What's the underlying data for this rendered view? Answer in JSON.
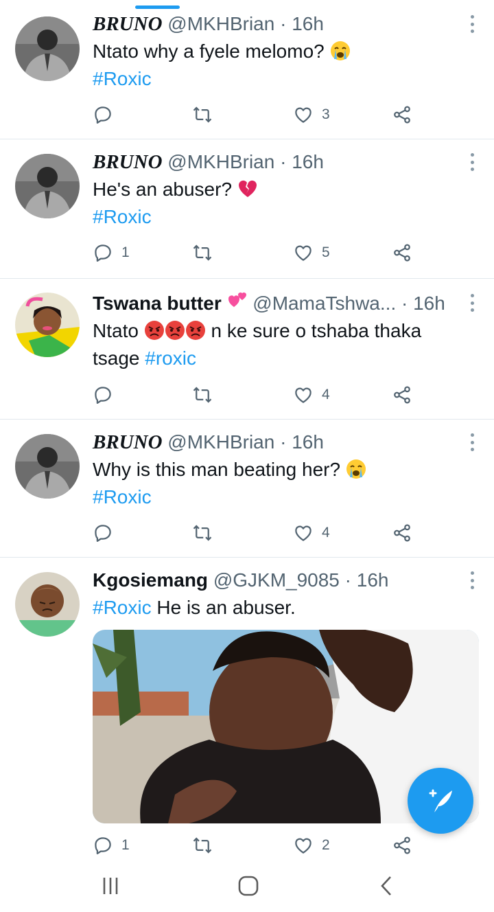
{
  "tweets": [
    {
      "name": "BRUNO",
      "handle": "@MKHBrian",
      "time": "16h",
      "text": "Ntato why a fyele melomo?",
      "hashtag": "#Roxic",
      "reply_count": "",
      "like_count": "3"
    },
    {
      "name": "BRUNO",
      "handle": "@MKHBrian",
      "time": "16h",
      "text": "He's an abuser?",
      "hashtag": "#Roxic",
      "reply_count": "1",
      "like_count": "5"
    },
    {
      "name": "Tswana butter",
      "handle": "@MamaTshwa...",
      "time": "16h",
      "text_part1": "Ntato",
      "text_part2": "n ke sure o tshaba thaka",
      "text_part3": "tsage",
      "hashtag": "#roxic",
      "reply_count": "",
      "like_count": "4"
    },
    {
      "name": "BRUNO",
      "handle": "@MKHBrian",
      "time": "16h",
      "text": "Why is this man beating her?",
      "hashtag": "#Roxic",
      "reply_count": "",
      "like_count": "4"
    },
    {
      "name": "Kgosiemang",
      "handle": "@GJKM_9085",
      "time": "16h",
      "hashtag": "#Roxic",
      "text": "He is an abuser.",
      "reply_count": "1",
      "like_count": "2"
    }
  ],
  "separator": "·",
  "icons": {
    "reply": "reply-icon",
    "retweet": "retweet-icon",
    "like": "heart-icon",
    "share": "share-icon",
    "more": "more-vertical-icon",
    "compose": "compose-tweet-icon",
    "nav_recent": "recent-apps-icon",
    "nav_home": "home-icon",
    "nav_back": "back-icon"
  },
  "colors": {
    "accent": "#1d9bf0",
    "text": "#0f1419",
    "secondary": "#536471",
    "divider": "#e1e8ed"
  }
}
